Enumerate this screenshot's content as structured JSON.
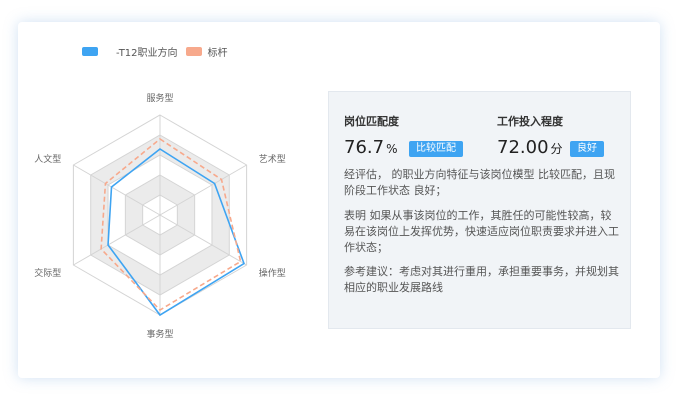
{
  "legend": {
    "items": [
      {
        "label": "-T12职业方向",
        "color": "#3ea4f2"
      },
      {
        "label": "标杆",
        "color": "#f7a98c"
      }
    ]
  },
  "chart_data": {
    "type": "radar",
    "axes": [
      "服务型",
      "艺术型",
      "操作型",
      "事务型",
      "交际型",
      "人文型"
    ],
    "series": [
      {
        "name": "-T12职业方向",
        "color": "#3ea4f2",
        "values": [
          0.66,
          0.63,
          0.97,
          1.0,
          0.6,
          0.56
        ]
      },
      {
        "name": "标杆",
        "color": "#f7a98c",
        "values": [
          0.76,
          0.71,
          0.93,
          0.95,
          0.68,
          0.63
        ]
      }
    ],
    "rings": 5,
    "ring_fills": [
      "#ffffff",
      "#ebebeb",
      "#ffffff",
      "#ebebeb",
      "#ffffff"
    ]
  },
  "panel": {
    "match": {
      "title": "岗位匹配度",
      "value": "76.7",
      "unit": "%",
      "badge": "比较匹配"
    },
    "engage": {
      "title": "工作投入程度",
      "value": "72.00",
      "unit": "分",
      "badge": "良好"
    },
    "evaluation": "经评估，      的职业方向特征与该岗位模型 比较匹配，且现阶段工作状态 良好；",
    "explanation": "表明      如果从事该岗位的工作，其胜任的可能性较高，较易在该岗位上发挥优势，快速适应岗位职责要求并进入工作状态；",
    "suggestion": "参考建议：考虑对其进行重用，承担重要事务，并规划其相应的职业发展路线"
  }
}
